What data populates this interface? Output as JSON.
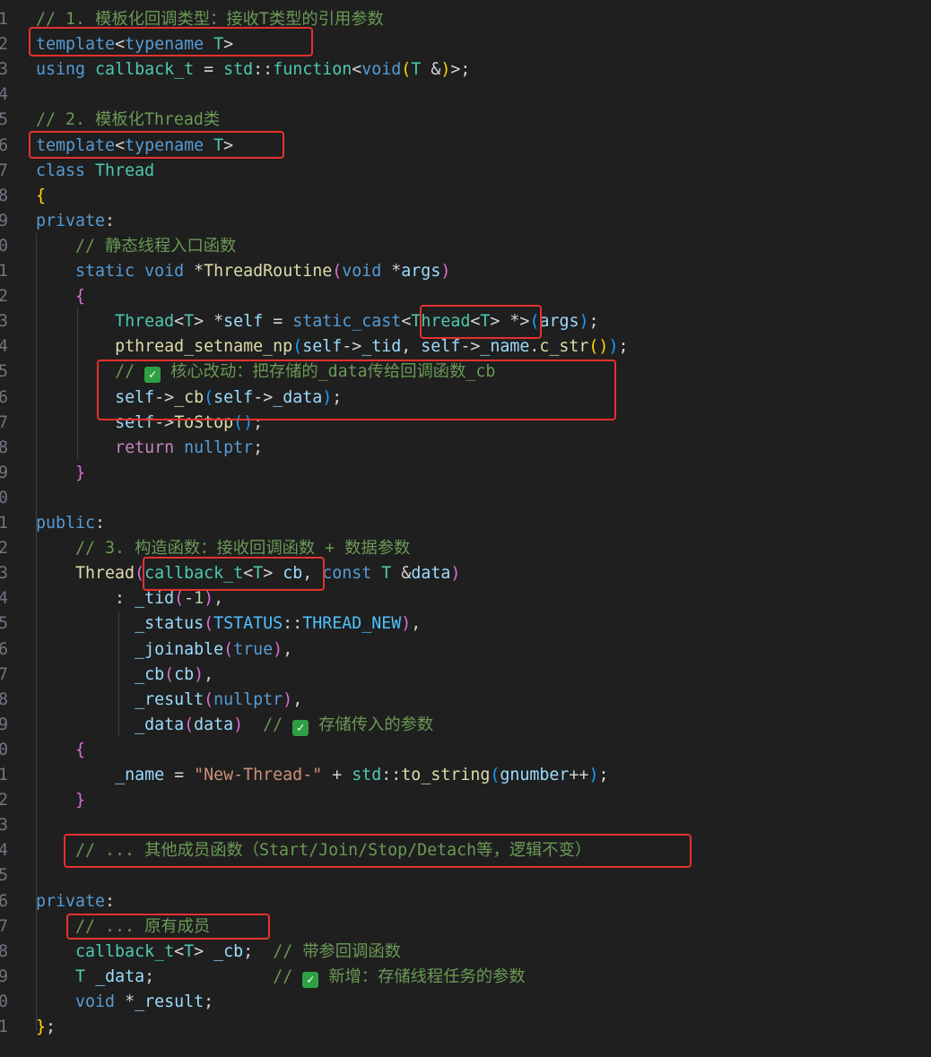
{
  "editor": {
    "language": "cpp",
    "lines": [
      {
        "n": "1",
        "tokens": [
          [
            "com",
            "// 1. 模板化回调类型：接收T类型的引用参数"
          ]
        ]
      },
      {
        "n": "2",
        "tokens": [
          [
            "kw",
            "template"
          ],
          [
            "op",
            "<"
          ],
          [
            "kw",
            "typename"
          ],
          [
            "op",
            " "
          ],
          [
            "ty",
            "T"
          ],
          [
            "op",
            ">"
          ]
        ]
      },
      {
        "n": "3",
        "tokens": [
          [
            "kw",
            "using"
          ],
          [
            "op",
            " "
          ],
          [
            "ty",
            "callback_t"
          ],
          [
            "op",
            " = "
          ],
          [
            "ty",
            "std"
          ],
          [
            "op",
            "::"
          ],
          [
            "ty",
            "function"
          ],
          [
            "op",
            "<"
          ],
          [
            "kw",
            "void"
          ],
          [
            "b1",
            "("
          ],
          [
            "ty",
            "T"
          ],
          [
            "op",
            " &"
          ],
          [
            "b1",
            ")"
          ],
          [
            "op",
            ">;"
          ]
        ]
      },
      {
        "n": "4",
        "tokens": []
      },
      {
        "n": "5",
        "tokens": [
          [
            "com",
            "// 2. 模板化Thread类"
          ]
        ]
      },
      {
        "n": "6",
        "tokens": [
          [
            "kw",
            "template"
          ],
          [
            "op",
            "<"
          ],
          [
            "kw",
            "typename"
          ],
          [
            "op",
            " "
          ],
          [
            "ty",
            "T"
          ],
          [
            "op",
            ">"
          ]
        ]
      },
      {
        "n": "7",
        "tokens": [
          [
            "kw",
            "class"
          ],
          [
            "op",
            " "
          ],
          [
            "ty",
            "Thread"
          ]
        ]
      },
      {
        "n": "8",
        "tokens": [
          [
            "b1",
            "{"
          ]
        ]
      },
      {
        "n": "9",
        "tokens": [
          [
            "kw",
            "private"
          ],
          [
            "op",
            ":"
          ]
        ]
      },
      {
        "n": "0",
        "tokens": [
          [
            "op",
            "    "
          ],
          [
            "com",
            "// 静态线程入口函数"
          ]
        ]
      },
      {
        "n": "1",
        "tokens": [
          [
            "op",
            "    "
          ],
          [
            "kw",
            "static"
          ],
          [
            "op",
            " "
          ],
          [
            "kw",
            "void"
          ],
          [
            "op",
            " *"
          ],
          [
            "fn",
            "ThreadRoutine"
          ],
          [
            "b2",
            "("
          ],
          [
            "kw",
            "void"
          ],
          [
            "op",
            " *"
          ],
          [
            "var",
            "args"
          ],
          [
            "b2",
            ")"
          ]
        ]
      },
      {
        "n": "2",
        "tokens": [
          [
            "op",
            "    "
          ],
          [
            "b2",
            "{"
          ]
        ]
      },
      {
        "n": "3",
        "tokens": [
          [
            "op",
            "        "
          ],
          [
            "ty",
            "Thread"
          ],
          [
            "op",
            "<"
          ],
          [
            "ty",
            "T"
          ],
          [
            "op",
            "> *"
          ],
          [
            "var",
            "self"
          ],
          [
            "op",
            " = "
          ],
          [
            "kw",
            "static_cast"
          ],
          [
            "op",
            "<"
          ],
          [
            "ty",
            "Thread"
          ],
          [
            "op",
            "<"
          ],
          [
            "ty",
            "T"
          ],
          [
            "op",
            "> *>"
          ],
          [
            "b3",
            "("
          ],
          [
            "var",
            "args"
          ],
          [
            "b3",
            ")"
          ],
          [
            "op",
            ";"
          ]
        ]
      },
      {
        "n": "4",
        "tokens": [
          [
            "op",
            "        "
          ],
          [
            "fn",
            "pthread_setname_np"
          ],
          [
            "b3",
            "("
          ],
          [
            "var",
            "self"
          ],
          [
            "op",
            "->"
          ],
          [
            "var",
            "_tid"
          ],
          [
            "op",
            ", "
          ],
          [
            "var",
            "self"
          ],
          [
            "op",
            "->"
          ],
          [
            "var",
            "_name"
          ],
          [
            "op",
            "."
          ],
          [
            "fn",
            "c_str"
          ],
          [
            "b1",
            "()"
          ],
          [
            "b3",
            ")"
          ],
          [
            "op",
            ";"
          ]
        ]
      },
      {
        "n": "5",
        "tokens": [
          [
            "op",
            "        "
          ],
          [
            "com",
            "// "
          ],
          [
            "chk",
            "✓"
          ],
          [
            "com",
            " 核心改动：把存储的_data传给回调函数_cb"
          ]
        ]
      },
      {
        "n": "6",
        "tokens": [
          [
            "op",
            "        "
          ],
          [
            "var",
            "self"
          ],
          [
            "op",
            "->"
          ],
          [
            "fn",
            "_cb"
          ],
          [
            "b3",
            "("
          ],
          [
            "var",
            "self"
          ],
          [
            "op",
            "->"
          ],
          [
            "var",
            "_data"
          ],
          [
            "b3",
            ")"
          ],
          [
            "op",
            ";"
          ]
        ]
      },
      {
        "n": "7",
        "tokens": [
          [
            "op",
            "        "
          ],
          [
            "var",
            "self"
          ],
          [
            "op",
            "->"
          ],
          [
            "fn",
            "ToStop"
          ],
          [
            "b3",
            "()"
          ],
          [
            "op",
            ";"
          ]
        ]
      },
      {
        "n": "8",
        "tokens": [
          [
            "op",
            "        "
          ],
          [
            "ctl",
            "return"
          ],
          [
            "op",
            " "
          ],
          [
            "kw",
            "nullptr"
          ],
          [
            "op",
            ";"
          ]
        ]
      },
      {
        "n": "9",
        "tokens": [
          [
            "op",
            "    "
          ],
          [
            "b2",
            "}"
          ]
        ]
      },
      {
        "n": "0",
        "tokens": []
      },
      {
        "n": "1",
        "tokens": [
          [
            "kw",
            "public"
          ],
          [
            "op",
            ":"
          ]
        ]
      },
      {
        "n": "2",
        "tokens": [
          [
            "op",
            "    "
          ],
          [
            "com",
            "// 3. 构造函数：接收回调函数 + 数据参数"
          ]
        ]
      },
      {
        "n": "3",
        "tokens": [
          [
            "op",
            "    "
          ],
          [
            "fn",
            "Thread"
          ],
          [
            "b2",
            "("
          ],
          [
            "ty",
            "callback_t"
          ],
          [
            "op",
            "<"
          ],
          [
            "ty",
            "T"
          ],
          [
            "op",
            "> "
          ],
          [
            "var",
            "cb"
          ],
          [
            "op",
            ", "
          ],
          [
            "kw",
            "const"
          ],
          [
            "op",
            " "
          ],
          [
            "ty",
            "T"
          ],
          [
            "op",
            " &"
          ],
          [
            "var",
            "data"
          ],
          [
            "b2",
            ")"
          ]
        ]
      },
      {
        "n": "4",
        "tokens": [
          [
            "op",
            "        : "
          ],
          [
            "var",
            "_tid"
          ],
          [
            "b2",
            "("
          ],
          [
            "op",
            "-"
          ],
          [
            "num",
            "1"
          ],
          [
            "b2",
            ")"
          ],
          [
            "op",
            ","
          ]
        ]
      },
      {
        "n": "5",
        "tokens": [
          [
            "op",
            "          "
          ],
          [
            "var",
            "_status"
          ],
          [
            "b2",
            "("
          ],
          [
            "mac",
            "TSTATUS"
          ],
          [
            "op",
            "::"
          ],
          [
            "mac",
            "THREAD_NEW"
          ],
          [
            "b2",
            ")"
          ],
          [
            "op",
            ","
          ]
        ]
      },
      {
        "n": "6",
        "tokens": [
          [
            "op",
            "          "
          ],
          [
            "var",
            "_joinable"
          ],
          [
            "b2",
            "("
          ],
          [
            "kw",
            "true"
          ],
          [
            "b2",
            ")"
          ],
          [
            "op",
            ","
          ]
        ]
      },
      {
        "n": "7",
        "tokens": [
          [
            "op",
            "          "
          ],
          [
            "var",
            "_cb"
          ],
          [
            "b2",
            "("
          ],
          [
            "var",
            "cb"
          ],
          [
            "b2",
            ")"
          ],
          [
            "op",
            ","
          ]
        ]
      },
      {
        "n": "8",
        "tokens": [
          [
            "op",
            "          "
          ],
          [
            "var",
            "_result"
          ],
          [
            "b2",
            "("
          ],
          [
            "kw",
            "nullptr"
          ],
          [
            "b2",
            ")"
          ],
          [
            "op",
            ","
          ]
        ]
      },
      {
        "n": "9",
        "tokens": [
          [
            "op",
            "          "
          ],
          [
            "var",
            "_data"
          ],
          [
            "b2",
            "("
          ],
          [
            "var",
            "data"
          ],
          [
            "b2",
            ")"
          ],
          [
            "op",
            "  "
          ],
          [
            "com",
            "// "
          ],
          [
            "chk",
            "✓"
          ],
          [
            "com",
            " 存储传入的参数"
          ]
        ]
      },
      {
        "n": "0",
        "tokens": [
          [
            "op",
            "    "
          ],
          [
            "b2",
            "{"
          ]
        ]
      },
      {
        "n": "1",
        "tokens": [
          [
            "op",
            "        "
          ],
          [
            "var",
            "_name"
          ],
          [
            "op",
            " = "
          ],
          [
            "str",
            "\"New-Thread-\""
          ],
          [
            "op",
            " + "
          ],
          [
            "ty",
            "std"
          ],
          [
            "op",
            "::"
          ],
          [
            "fn",
            "to_string"
          ],
          [
            "b3",
            "("
          ],
          [
            "var",
            "gnumber"
          ],
          [
            "op",
            "++"
          ],
          [
            "b3",
            ")"
          ],
          [
            "op",
            ";"
          ]
        ]
      },
      {
        "n": "2",
        "tokens": [
          [
            "op",
            "    "
          ],
          [
            "b2",
            "}"
          ]
        ]
      },
      {
        "n": "3",
        "tokens": []
      },
      {
        "n": "4",
        "tokens": [
          [
            "op",
            "    "
          ],
          [
            "com",
            "// ... 其他成员函数（Start/Join/Stop/Detach等，逻辑不变）"
          ]
        ]
      },
      {
        "n": "5",
        "tokens": []
      },
      {
        "n": "6",
        "tokens": [
          [
            "kw",
            "private"
          ],
          [
            "op",
            ":"
          ]
        ]
      },
      {
        "n": "7",
        "tokens": [
          [
            "op",
            "    "
          ],
          [
            "com",
            "// ... 原有成员"
          ]
        ]
      },
      {
        "n": "8",
        "tokens": [
          [
            "op",
            "    "
          ],
          [
            "ty",
            "callback_t"
          ],
          [
            "op",
            "<"
          ],
          [
            "ty",
            "T"
          ],
          [
            "op",
            "> "
          ],
          [
            "var",
            "_cb"
          ],
          [
            "op",
            ";  "
          ],
          [
            "com",
            "// 带参回调函数"
          ]
        ]
      },
      {
        "n": "9",
        "tokens": [
          [
            "op",
            "    "
          ],
          [
            "ty",
            "T"
          ],
          [
            "op",
            " "
          ],
          [
            "var",
            "_data"
          ],
          [
            "op",
            ";            "
          ],
          [
            "com",
            "// "
          ],
          [
            "chk",
            "✓"
          ],
          [
            "com",
            " 新增：存储线程任务的参数"
          ]
        ]
      },
      {
        "n": "0",
        "tokens": [
          [
            "op",
            "    "
          ],
          [
            "kw",
            "void"
          ],
          [
            "op",
            " *"
          ],
          [
            "var",
            "_result"
          ],
          [
            "op",
            ";"
          ]
        ]
      },
      {
        "n": "1",
        "tokens": [
          [
            "b1",
            "}"
          ],
          [
            "op",
            ";"
          ]
        ]
      }
    ]
  }
}
